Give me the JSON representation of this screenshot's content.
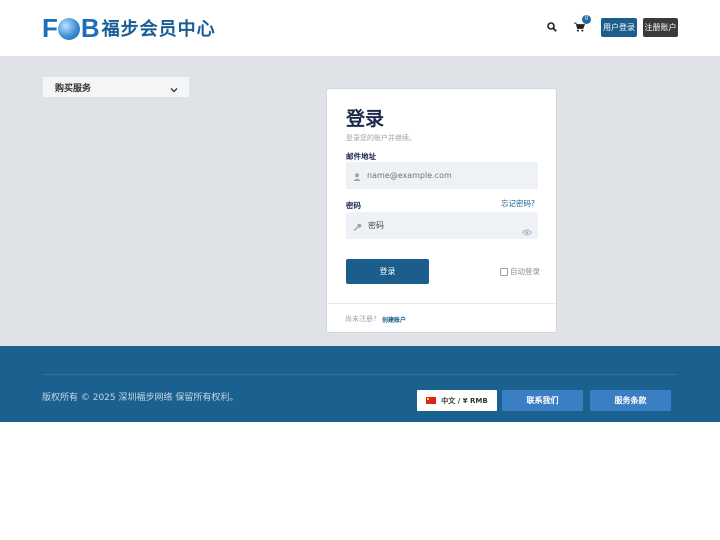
{
  "header": {
    "logo_text": "FOB",
    "logo_cn": "福步会员中心",
    "cart_count": "0",
    "login_label": "用户登录",
    "register_label": "注册账户"
  },
  "sidebar": {
    "panel_title": "购买服务"
  },
  "login": {
    "title": "登录",
    "subtitle": "登录您的账户并继续。",
    "email_label": "邮件地址",
    "email_placeholder": "name@example.com",
    "password_label": "密码",
    "password_placeholder": "密码",
    "forgot_label": "忘记密码?",
    "submit_label": "登录",
    "remember_label": "自动登录",
    "no_account_text": "尚未注册?",
    "create_account_label": "创建账户"
  },
  "footer": {
    "copyright": "版权所有 © 2025 深圳福步网络 保留所有权利。",
    "language_label": "中文 / ¥ RMB",
    "contact_label": "联系我们",
    "terms_label": "服务条款"
  },
  "colors": {
    "brand": "#1b5e8c",
    "footer": "#1b6190",
    "accent_button": "#3a7ec4"
  }
}
